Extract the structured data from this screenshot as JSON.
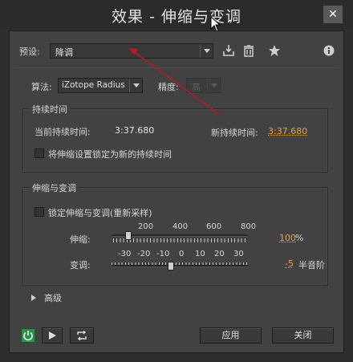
{
  "window": {
    "title": "效果 - 伸缩与变调",
    "close_glyph": "✕"
  },
  "preset": {
    "label": "预设:",
    "value": "降调"
  },
  "toolbar": {
    "save_icon": "save-preset-icon",
    "delete_icon": "trash-icon",
    "favorite_icon": "star-icon",
    "info_icon": "info-icon"
  },
  "algorithm": {
    "label": "算法:",
    "value": "iZotope Radius",
    "precision_label": "精度:",
    "precision_value": "高"
  },
  "duration": {
    "group_title": "持续时间",
    "current_label": "当前持续时间:",
    "current_value": "3:37.680",
    "new_label": "新持续时间:",
    "new_value": "3:37.680",
    "lock_label": "将伸缩设置锁定为新的持续时间"
  },
  "stretch_pitch": {
    "group_title": "伸缩与变调",
    "lock_label": "锁定伸缩与变调(重新采样)",
    "stretch_label": "伸缩:",
    "stretch_ticks": [
      "200",
      "400",
      "600",
      "800"
    ],
    "stretch_value": "100",
    "stretch_unit": "%",
    "pitch_label": "变调:",
    "pitch_ticks": [
      "-30",
      "-20",
      "-10",
      "0",
      "10",
      "20",
      "30"
    ],
    "pitch_value": "-5",
    "pitch_unit": "半音阶"
  },
  "advanced": {
    "label": "高级"
  },
  "footer": {
    "apply_label": "应用",
    "close_label": "关闭"
  },
  "colors": {
    "accent": "#e6a33d",
    "annotation_arrow": "#c0191d",
    "power_on": "#2f8f4f"
  }
}
